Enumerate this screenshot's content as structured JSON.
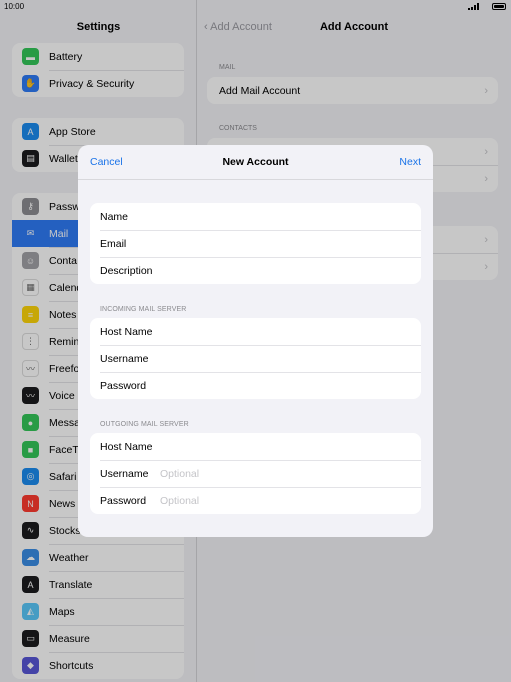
{
  "status": {
    "time": "10:00"
  },
  "sidebar": {
    "title": "Settings",
    "groups": [
      [
        {
          "label": "Battery",
          "icon": "battery-icon",
          "color": "#34c759",
          "glyph": "▬"
        },
        {
          "label": "Privacy & Security",
          "icon": "hand-icon",
          "color": "#2f7cf6",
          "glyph": "✋"
        }
      ],
      [
        {
          "label": "App Store",
          "icon": "app-store-icon",
          "color": "#1c8cf0",
          "glyph": "A"
        },
        {
          "label": "Wallet",
          "icon": "wallet-icon",
          "color": "#1c1c1e",
          "glyph": "▤"
        }
      ],
      [
        {
          "label": "Passw",
          "icon": "key-icon",
          "color": "#8e8e93",
          "glyph": "⚷"
        },
        {
          "label": "Mail",
          "icon": "mail-icon",
          "color": "#2f7cf6",
          "glyph": "✉",
          "selected": true
        },
        {
          "label": "Conta",
          "icon": "contacts-icon",
          "color": "#a2a2a7",
          "glyph": "☺"
        },
        {
          "label": "Calend",
          "icon": "calendar-icon",
          "color": "#ffffff",
          "glyph": "▦"
        },
        {
          "label": "Notes",
          "icon": "notes-icon",
          "color": "#ffd60a",
          "glyph": "≡"
        },
        {
          "label": "Remin",
          "icon": "reminders-icon",
          "color": "#ffffff",
          "glyph": "⋮"
        },
        {
          "label": "Freefo",
          "icon": "freeform-icon",
          "color": "#ffffff",
          "glyph": "〰"
        },
        {
          "label": "Voice",
          "icon": "voice-memos-icon",
          "color": "#1c1c1e",
          "glyph": "〰"
        },
        {
          "label": "Messa",
          "icon": "messages-icon",
          "color": "#34c759",
          "glyph": "●"
        },
        {
          "label": "FaceTi",
          "icon": "facetime-icon",
          "color": "#34c759",
          "glyph": "■"
        },
        {
          "label": "Safari",
          "icon": "safari-icon",
          "color": "#1c8cf0",
          "glyph": "◎"
        },
        {
          "label": "News",
          "icon": "news-icon",
          "color": "#ff3b30",
          "glyph": "N"
        },
        {
          "label": "Stocks",
          "icon": "stocks-icon",
          "color": "#1c1c1e",
          "glyph": "∿"
        },
        {
          "label": "Weather",
          "icon": "weather-icon",
          "color": "#3a8ee6",
          "glyph": "☁"
        },
        {
          "label": "Translate",
          "icon": "translate-icon",
          "color": "#1c1c1e",
          "glyph": "A"
        },
        {
          "label": "Maps",
          "icon": "maps-icon",
          "color": "#5ac8fa",
          "glyph": "◭"
        },
        {
          "label": "Measure",
          "icon": "measure-icon",
          "color": "#1c1c1e",
          "glyph": "▭"
        },
        {
          "label": "Shortcuts",
          "icon": "shortcuts-icon",
          "color": "#5856d6",
          "glyph": "◆"
        }
      ]
    ]
  },
  "detail": {
    "back": "Add Account",
    "title": "Add Account",
    "sections": [
      {
        "header": "MAIL",
        "rows": [
          "Add Mail Account"
        ]
      },
      {
        "header": "CONTACTS",
        "rows": [
          "",
          ""
        ]
      },
      {
        "header": "",
        "rows": [
          "",
          ""
        ]
      }
    ]
  },
  "modal": {
    "cancel": "Cancel",
    "title": "New Account",
    "next": "Next",
    "account": [
      {
        "label": "Name",
        "placeholder": ""
      },
      {
        "label": "Email",
        "placeholder": ""
      },
      {
        "label": "Description",
        "placeholder": ""
      }
    ],
    "incoming_header": "INCOMING MAIL SERVER",
    "incoming": [
      {
        "label": "Host Name",
        "placeholder": ""
      },
      {
        "label": "Username",
        "placeholder": ""
      },
      {
        "label": "Password",
        "placeholder": ""
      }
    ],
    "outgoing_header": "OUTGOING MAIL SERVER",
    "outgoing": [
      {
        "label": "Host Name",
        "placeholder": ""
      },
      {
        "label": "Username",
        "placeholder": "Optional"
      },
      {
        "label": "Password",
        "placeholder": "Optional"
      }
    ]
  }
}
